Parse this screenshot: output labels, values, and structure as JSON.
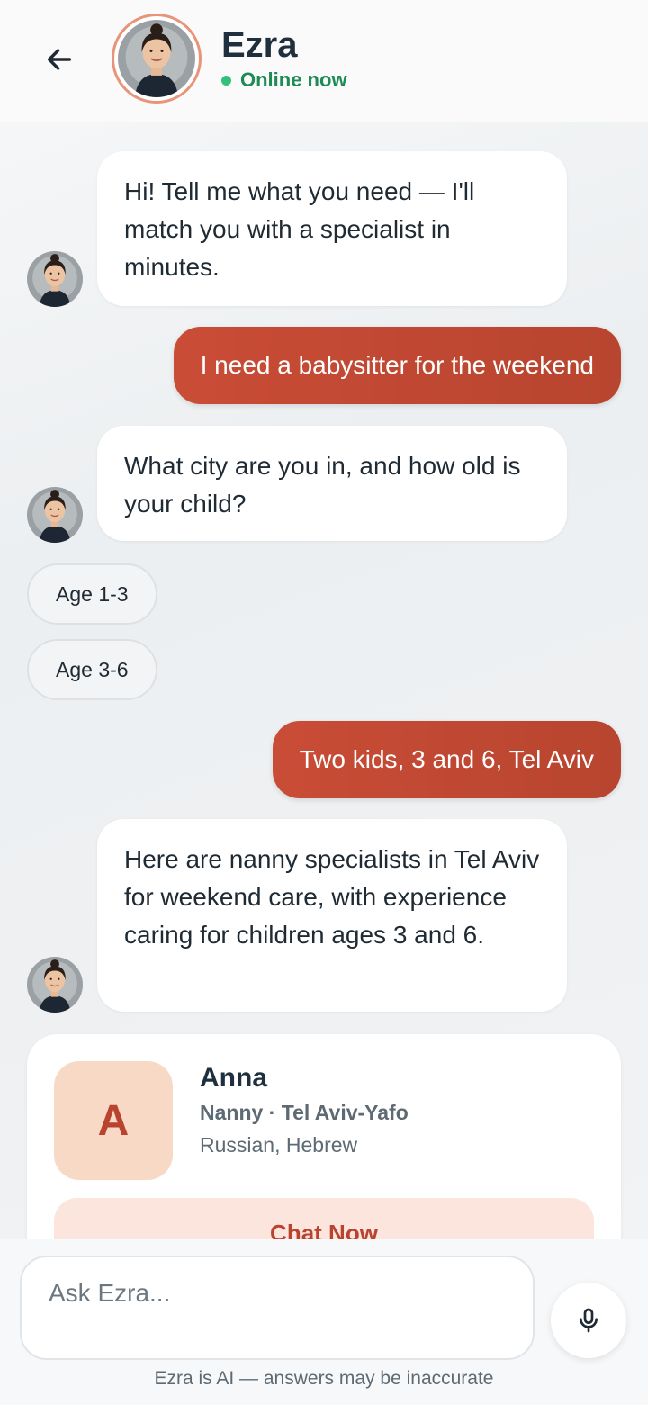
{
  "header": {
    "back_icon": "arrow-left-icon",
    "name": "Ezra",
    "status": "Online now",
    "status_color": "#34c07c"
  },
  "messages": [
    {
      "from": "bot",
      "text": "Hi! Tell me what you need — I'll match you with a specialist in minutes."
    },
    {
      "from": "user",
      "text": "I need a babysitter for the weekend"
    },
    {
      "from": "bot",
      "text": "What city are you in, and how old is your child?"
    },
    {
      "from": "user",
      "text": "Two kids, 3 and 6, Tel Aviv"
    },
    {
      "from": "bot",
      "text": "Here are nanny specialists in Tel Aviv for weekend care, with experience caring for children ages 3 and 6."
    }
  ],
  "quick_replies": [
    "Age 1-3",
    "Age 3-6"
  ],
  "specialist_card": {
    "initial": "A",
    "name": "Anna",
    "role": "Nanny · Tel Aviv-Yafo",
    "languages": "Russian, Hebrew",
    "button_label": "Chat Now"
  },
  "composer": {
    "placeholder": "Ask Ezra...",
    "mic_icon": "microphone-icon",
    "disclaimer": "Ezra is AI — answers may be inaccurate"
  },
  "colors": {
    "accent": "#c0482f",
    "user_bubble": "#c94c36",
    "card_badge_bg": "#f8d9c6",
    "button_bg": "#fbe5dc"
  }
}
